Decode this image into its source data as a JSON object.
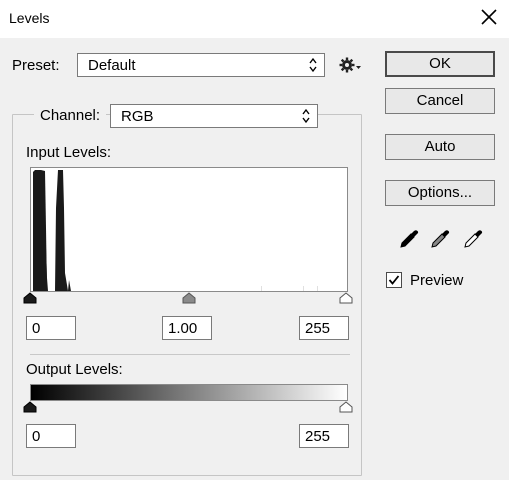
{
  "window": {
    "title": "Levels"
  },
  "preset": {
    "label": "Preset:",
    "value": "Default"
  },
  "channel": {
    "label": "Channel:",
    "value": "RGB"
  },
  "input_levels": {
    "label": "Input Levels:",
    "black": "0",
    "midtone": "1.00",
    "white": "255"
  },
  "output_levels": {
    "label": "Output Levels:",
    "black": "0",
    "white": "255"
  },
  "buttons": {
    "ok": "OK",
    "cancel": "Cancel",
    "auto": "Auto",
    "options": "Options..."
  },
  "preview": {
    "label": "Preview",
    "checked": true
  },
  "icons": {
    "close": "close-icon",
    "gear": "gear-icon",
    "black_eyedropper": "eyedropper-black-icon",
    "gray_eyedropper": "eyedropper-gray-icon",
    "white_eyedropper": "eyedropper-white-icon"
  },
  "colors": {
    "dialog_bg": "#f0f0f0",
    "titlebar_bg": "#ffffff",
    "histogram": "#1a1a1a"
  }
}
